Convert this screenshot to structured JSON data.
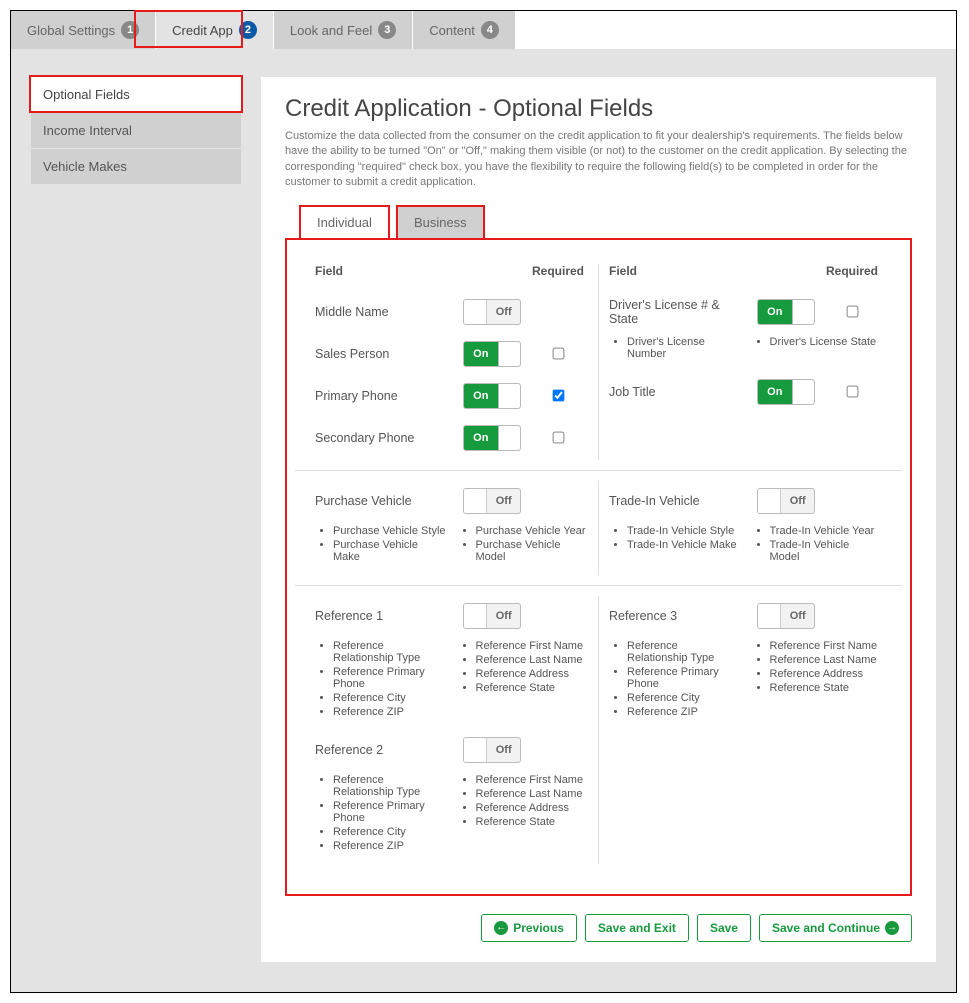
{
  "accent_green": "#179a3e",
  "highlight_red": "#e51b1b",
  "step_tabs": [
    {
      "label": "Global Settings",
      "num": "1",
      "active": false
    },
    {
      "label": "Credit App",
      "num": "2",
      "active": true
    },
    {
      "label": "Look and Feel",
      "num": "3",
      "active": false
    },
    {
      "label": "Content",
      "num": "4",
      "active": false
    }
  ],
  "sidebar": {
    "items": [
      {
        "label": "Optional Fields",
        "active": true
      },
      {
        "label": "Income Interval",
        "active": false
      },
      {
        "label": "Vehicle Makes",
        "active": false
      }
    ]
  },
  "title": "Credit Application - Optional Fields",
  "description": "Customize the data collected from the consumer on the credit application to fit your dealership's requirements. The fields below have the ability to be turned \"On\" or \"Off,\" making them visible (or not) to the customer on the credit application. By selecting the corresponding \"required\" check box, you have the flexibility to require the following field(s) to be completed in order for the customer to submit a credit application.",
  "subtabs": {
    "individual": "Individual",
    "business": "Business"
  },
  "headers": {
    "field": "Field",
    "required": "Required"
  },
  "toggle_labels": {
    "on": "On",
    "off": "Off"
  },
  "section1": {
    "left": [
      {
        "label": "Middle Name",
        "state": "off",
        "required": null
      },
      {
        "label": "Sales Person",
        "state": "on",
        "required": false
      },
      {
        "label": "Primary Phone",
        "state": "on",
        "required": true
      },
      {
        "label": "Secondary Phone",
        "state": "on",
        "required": false
      }
    ],
    "right": [
      {
        "label": "Driver's License # & State",
        "state": "on",
        "required": false,
        "bullets_left": [
          "Driver's License Number"
        ],
        "bullets_right": [
          "Driver's License State"
        ]
      },
      {
        "label": "Job Title",
        "state": "on",
        "required": false
      }
    ]
  },
  "section2": {
    "left": {
      "label": "Purchase Vehicle",
      "state": "off",
      "bullets_left": [
        "Purchase Vehicle Style",
        "Purchase Vehicle Make"
      ],
      "bullets_right": [
        "Purchase Vehicle Year",
        "Purchase Vehicle Model"
      ]
    },
    "right": {
      "label": "Trade-In Vehicle",
      "state": "off",
      "bullets_left": [
        "Trade-In Vehicle Style",
        "Trade-In Vehicle Make"
      ],
      "bullets_right": [
        "Trade-In Vehicle Year",
        "Trade-In Vehicle Model"
      ]
    }
  },
  "section3": {
    "left": [
      {
        "label": "Reference 1",
        "state": "off",
        "bullets_left": [
          "Reference Relationship Type",
          "Reference Primary Phone",
          "Reference City",
          "Reference ZIP"
        ],
        "bullets_right": [
          "Reference First Name",
          "Reference Last Name",
          "Reference Address",
          "Reference State"
        ]
      },
      {
        "label": "Reference 2",
        "state": "off",
        "bullets_left": [
          "Reference Relationship Type",
          "Reference Primary Phone",
          "Reference City",
          "Reference ZIP"
        ],
        "bullets_right": [
          "Reference First Name",
          "Reference Last Name",
          "Reference Address",
          "Reference State"
        ]
      }
    ],
    "right": [
      {
        "label": "Reference 3",
        "state": "off",
        "bullets_left": [
          "Reference Relationship Type",
          "Reference Primary Phone",
          "Reference City",
          "Reference ZIP"
        ],
        "bullets_right": [
          "Reference First Name",
          "Reference Last Name",
          "Reference Address",
          "Reference State"
        ]
      }
    ]
  },
  "footer": {
    "previous": "Previous",
    "save_exit": "Save and Exit",
    "save": "Save",
    "save_continue": "Save and Continue"
  }
}
